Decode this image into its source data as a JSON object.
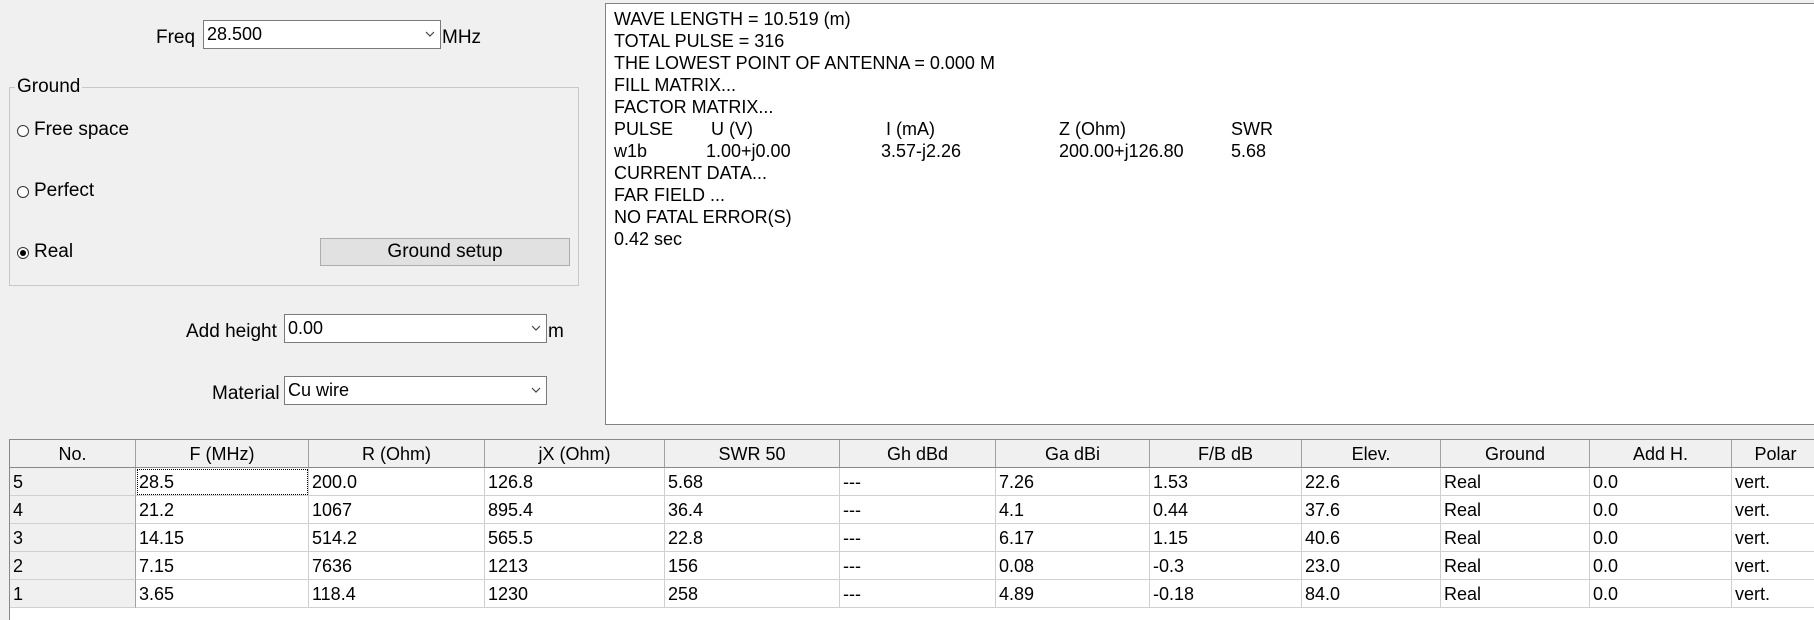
{
  "freq": {
    "label": "Freq",
    "value": "28.500",
    "unit": "MHz"
  },
  "ground": {
    "title": "Ground",
    "options": [
      "Free space",
      "Perfect",
      "Real"
    ],
    "selected": "Real",
    "setup_button": "Ground setup"
  },
  "add_height": {
    "label": "Add height",
    "value": "0.00",
    "unit": "m"
  },
  "material": {
    "label": "Material",
    "value": "Cu wire"
  },
  "log": {
    "lines": [
      "WAVE LENGTH = 10.519 (m)",
      "TOTAL PULSE = 316",
      "THE LOWEST POINT OF ANTENNA = 0.000 M",
      "FILL MATRIX...",
      "FACTOR MATRIX..."
    ],
    "pulse_header": [
      "PULSE",
      "U (V)",
      "I (mA)",
      "Z (Ohm)",
      "SWR"
    ],
    "pulse_row": [
      "w1b",
      "1.00+j0.00",
      "3.57-j2.26",
      "200.00+j126.80",
      "5.68"
    ],
    "tail_lines": [
      "CURRENT DATA...",
      "FAR FIELD ...",
      "NO FATAL ERROR(S)",
      "0.42 sec"
    ]
  },
  "table": {
    "columns": [
      "No.",
      "F (MHz)",
      "R (Ohm)",
      "jX (Ohm)",
      "SWR 50",
      "Gh dBd",
      "Ga dBi",
      "F/B dB",
      "Elev.",
      "Ground",
      "Add H.",
      "Polar"
    ],
    "rows": [
      [
        "5",
        "28.5",
        "200.0",
        "126.8",
        "5.68",
        "---",
        "7.26",
        "1.53",
        "22.6",
        "Real",
        "0.0",
        "vert."
      ],
      [
        "4",
        "21.2",
        "1067",
        "895.4",
        "36.4",
        "---",
        "4.1",
        "0.44",
        "37.6",
        "Real",
        "0.0",
        "vert."
      ],
      [
        "3",
        "14.15",
        "514.2",
        "565.5",
        "22.8",
        "---",
        "6.17",
        "1.15",
        "40.6",
        "Real",
        "0.0",
        "vert."
      ],
      [
        "2",
        "7.15",
        "7636",
        "1213",
        "156",
        "---",
        "0.08",
        "-0.3",
        "23.0",
        "Real",
        "0.0",
        "vert."
      ],
      [
        "1",
        "3.65",
        "118.4",
        "1230",
        "258",
        "---",
        "4.89",
        "-0.18",
        "84.0",
        "Real",
        "0.0",
        "vert."
      ]
    ]
  }
}
